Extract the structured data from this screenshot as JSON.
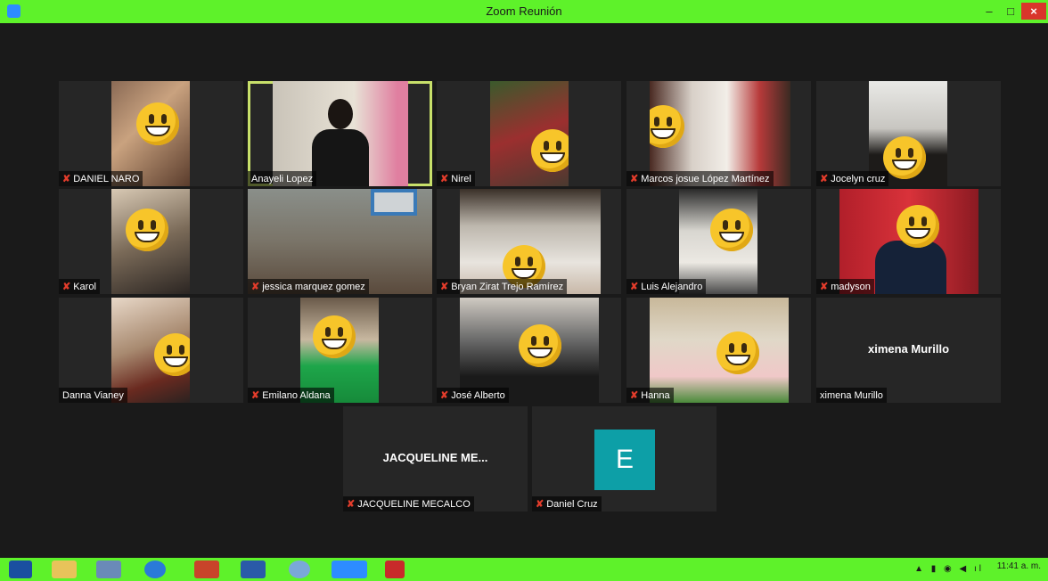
{
  "window": {
    "title": "Zoom Reunión",
    "minimize": "–",
    "maximize": "□",
    "close": "×"
  },
  "participants": [
    {
      "name": "DANIEL NARO",
      "muted": true
    },
    {
      "name": "Anayeli Lopez",
      "muted": false,
      "active_speaker": true
    },
    {
      "name": "Nirel",
      "muted": true
    },
    {
      "name": "Marcos josue López Martínez",
      "muted": true
    },
    {
      "name": "Jocelyn cruz",
      "muted": true
    },
    {
      "name": "Karol",
      "muted": true
    },
    {
      "name": "jessica marquez gomez",
      "muted": true
    },
    {
      "name": "Bryan Zirat Trejo Ramírez",
      "muted": true
    },
    {
      "name": "Luis Alejandro",
      "muted": true
    },
    {
      "name": "madyson",
      "muted": true
    },
    {
      "name": "Danna Vianey",
      "muted": false
    },
    {
      "name": "Emilano Aldana",
      "muted": true
    },
    {
      "name": "José Alberto",
      "muted": true
    },
    {
      "name": "Hanna",
      "muted": true
    },
    {
      "name": "ximena Murillo",
      "muted": false,
      "display_name": "ximena Murillo"
    },
    {
      "name": "JACQUELINE MECALCO",
      "muted": true,
      "display_name": "JACQUELINE ME..."
    },
    {
      "name": "Daniel Cruz",
      "muted": true,
      "avatar_letter": "E"
    }
  ],
  "taskbar": {
    "clock": "11:41 a. m.",
    "tray": "▲ ▮ ◉ ◀ ıl"
  },
  "colors": {
    "accent_green": "#5ef22a",
    "avatar_teal": "#0d9fa7",
    "active_border": "#c8e06a",
    "muted_red": "#e23c2b"
  }
}
